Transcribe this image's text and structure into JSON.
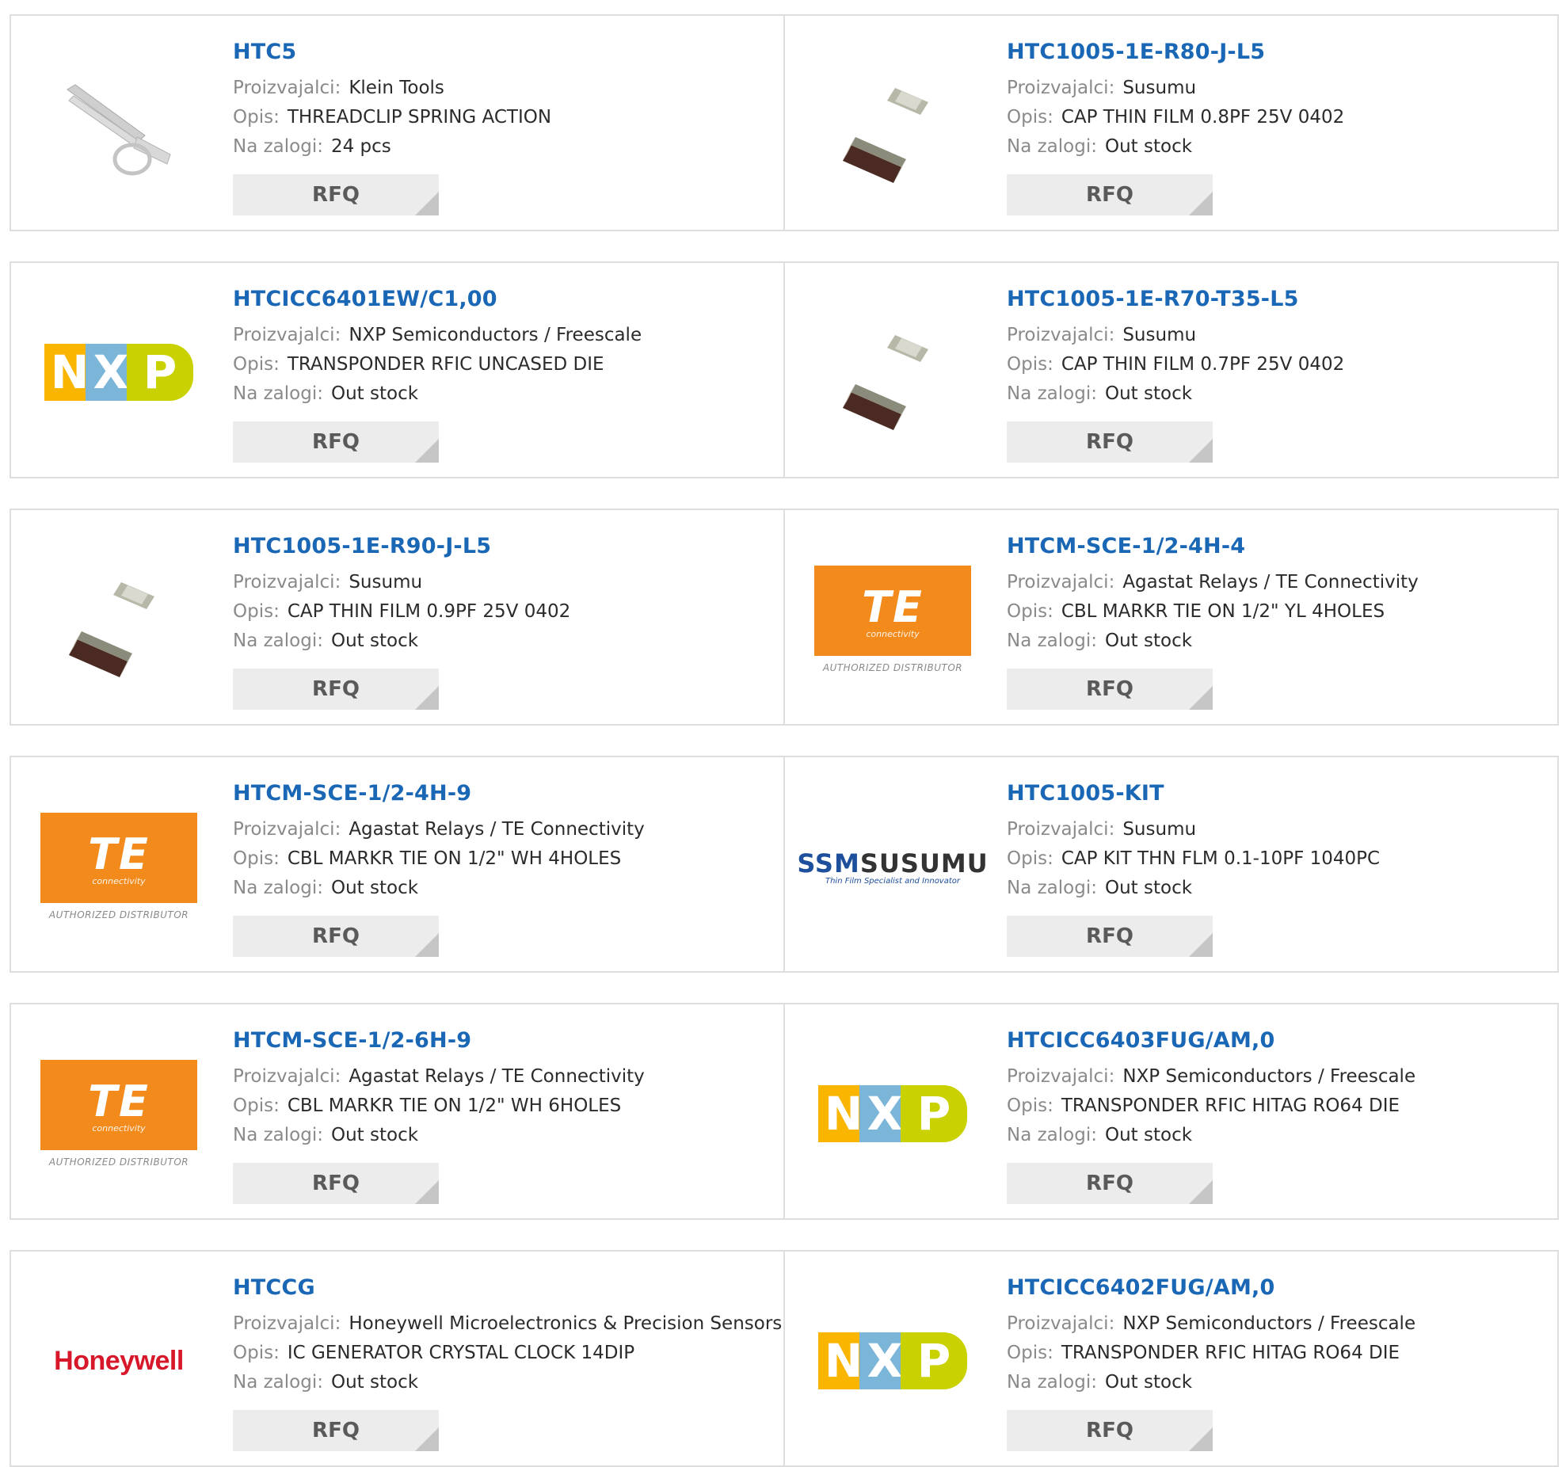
{
  "labels": {
    "manufacturer": "Proizvajalci:",
    "description": "Opis:",
    "stock": "Na zalogi:",
    "rfq": "RFQ"
  },
  "products": [
    {
      "part": "HTC5",
      "manufacturer": "Klein Tools",
      "description": "THREADCLIP SPRING ACTION",
      "stock": "24 pcs",
      "image": "scissors-photo"
    },
    {
      "part": "HTC1005-1E-R80-J-L5",
      "manufacturer": "Susumu",
      "description": "CAP THIN FILM 0.8PF 25V 0402",
      "stock": "Out stock",
      "image": "chip-capacitor-photo"
    },
    {
      "part": "HTCICC6401EW/C1,00",
      "manufacturer": "NXP Semiconductors / Freescale",
      "description": "TRANSPONDER RFIC UNCASED DIE",
      "stock": "Out stock",
      "image": "nxp-logo"
    },
    {
      "part": "HTC1005-1E-R70-T35-L5",
      "manufacturer": "Susumu",
      "description": "CAP THIN FILM 0.7PF 25V 0402",
      "stock": "Out stock",
      "image": "chip-capacitor-photo"
    },
    {
      "part": "HTC1005-1E-R90-J-L5",
      "manufacturer": "Susumu",
      "description": "CAP THIN FILM 0.9PF 25V 0402",
      "stock": "Out stock",
      "image": "chip-capacitor-photo"
    },
    {
      "part": "HTCM-SCE-1/2-4H-4",
      "manufacturer": "Agastat Relays / TE Connectivity",
      "description": "CBL MARKR TIE ON 1/2\" YL 4HOLES",
      "stock": "Out stock",
      "image": "te-logo"
    },
    {
      "part": "HTCM-SCE-1/2-4H-9",
      "manufacturer": "Agastat Relays / TE Connectivity",
      "description": "CBL MARKR TIE ON 1/2\" WH 4HOLES",
      "stock": "Out stock",
      "image": "te-logo"
    },
    {
      "part": "HTC1005-KIT",
      "manufacturer": "Susumu",
      "description": "CAP KIT THN FLM 0.1-10PF 1040PC",
      "stock": "Out stock",
      "image": "susumu-logo"
    },
    {
      "part": "HTCM-SCE-1/2-6H-9",
      "manufacturer": "Agastat Relays / TE Connectivity",
      "description": "CBL MARKR TIE ON 1/2\" WH 6HOLES",
      "stock": "Out stock",
      "image": "te-logo"
    },
    {
      "part": "HTCICC6403FUG/AM,0",
      "manufacturer": "NXP Semiconductors / Freescale",
      "description": "TRANSPONDER RFIC HITAG RO64 DIE",
      "stock": "Out stock",
      "image": "nxp-logo"
    },
    {
      "part": "HTCCG",
      "manufacturer": "Honeywell Microelectronics & Precision Sensors",
      "description": "IC GENERATOR CRYSTAL CLOCK 14DIP",
      "stock": "Out stock",
      "image": "honeywell-logo"
    },
    {
      "part": "HTCICC6402FUG/AM,0",
      "manufacturer": "NXP Semiconductors / Freescale",
      "description": "TRANSPONDER RFIC HITAG RO64 DIE",
      "stock": "Out stock",
      "image": "nxp-logo"
    }
  ],
  "logos": {
    "nxp": [
      "N",
      "X",
      "P"
    ],
    "te": {
      "mark": "TE",
      "tagline": "connectivity",
      "badge": "AUTHORIZED DISTRIBUTOR"
    },
    "susumu": {
      "mark_a": "SSM",
      "mark_b": "SUSUMU",
      "tagline": "Thin Film Specialist and Innovator"
    },
    "honeywell": "Honeywell"
  },
  "colors": {
    "part_link": "#1a67b5",
    "label": "#8a8a8a",
    "value": "#2b2b2b",
    "rfq_bg": "#ececec",
    "card_border": "#dedede",
    "te_orange": "#f28a1c",
    "honeywell_red": "#d6182a",
    "nxp_yellow": "#f9b500",
    "nxp_blue": "#7bb6d9",
    "nxp_green": "#c9d200"
  }
}
